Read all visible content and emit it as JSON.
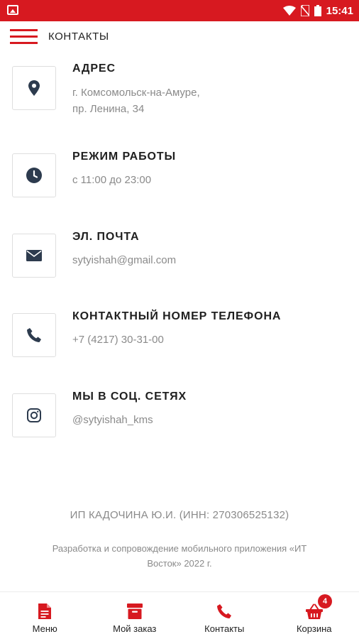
{
  "status_bar": {
    "time": "15:41"
  },
  "app_bar": {
    "title": "КОНТАКТЫ"
  },
  "contacts": [
    {
      "label": "АДРЕС",
      "value_lines": [
        "г. Комсомольск-на-Амуре,",
        "пр. Ленина, 34"
      ],
      "icon": "map-marker-icon"
    },
    {
      "label": "РЕЖИМ РАБОТЫ",
      "value_lines": [
        "с 11:00 до 23:00"
      ],
      "icon": "clock-icon"
    },
    {
      "label": "ЭЛ. ПОЧТА",
      "value_lines": [
        "sytyishah@gmail.com"
      ],
      "icon": "envelope-icon"
    },
    {
      "label": "КОНТАКТНЫЙ НОМЕР ТЕЛЕФОНА",
      "value_lines": [
        "+7 (4217) 30-31-00"
      ],
      "icon": "phone-icon"
    },
    {
      "label": "МЫ В СОЦ. СЕТЯХ",
      "value_lines": [
        "@sytyishah_kms"
      ],
      "icon": "instagram-icon"
    }
  ],
  "footer": {
    "company": "ИП КАДОЧИНА Ю.И. (ИНН: 270306525132)",
    "developer_line1": "Разработка и сопровождение мобильного приложения «ИТ",
    "developer_line2": "Восток» 2022 г."
  },
  "bottom_nav": {
    "items": [
      {
        "label": "Меню",
        "icon": "document-icon"
      },
      {
        "label": "Мой заказ",
        "icon": "archive-box-icon"
      },
      {
        "label": "Контакты",
        "icon": "phone-icon"
      },
      {
        "label": "Корзина",
        "icon": "basket-icon"
      }
    ],
    "cart_badge": "4"
  },
  "colors": {
    "accent": "#d71920",
    "icon_dark": "#2d3b4e",
    "text_muted": "#8a8a8a"
  }
}
